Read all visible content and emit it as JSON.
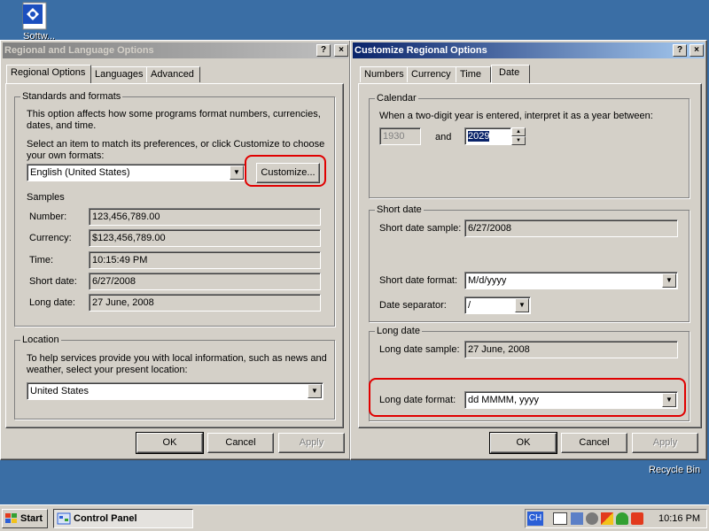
{
  "desktop": {
    "top_icon_label": "Softw...",
    "recycle_bin_label": "Recycle Bin"
  },
  "left_window": {
    "title": "Regional and Language Options",
    "help_btn": "?",
    "close_btn": "×",
    "tabs": [
      "Regional Options",
      "Languages",
      "Advanced"
    ],
    "standards": {
      "title": "Standards and formats",
      "description": "This option affects how some programs format numbers, currencies, dates, and time.",
      "instruction": "Select an item to match its preferences, or click Customize to choose your own formats:",
      "selected_locale": "English (United States)",
      "customize_label": "Customize...",
      "samples_title": "Samples",
      "samples": [
        {
          "label": "Number:",
          "value": "123,456,789.00"
        },
        {
          "label": "Currency:",
          "value": "$123,456,789.00"
        },
        {
          "label": "Time:",
          "value": "10:15:49 PM"
        },
        {
          "label": "Short date:",
          "value": "6/27/2008"
        },
        {
          "label": "Long date:",
          "value": "27 June, 2008"
        }
      ]
    },
    "location": {
      "title": "Location",
      "description": "To help services provide you with local information, such as news and weather, select your present location:",
      "selected": "United States"
    },
    "buttons": {
      "ok": "OK",
      "cancel": "Cancel",
      "apply": "Apply"
    }
  },
  "right_window": {
    "title": "Customize Regional Options",
    "help_btn": "?",
    "close_btn": "×",
    "tabs": [
      "Numbers",
      "Currency",
      "Time",
      "Date"
    ],
    "calendar": {
      "title": "Calendar",
      "description": "When a two-digit year is entered, interpret it as a year between:",
      "from_year": "1930",
      "and_label": "and",
      "to_year": "2029"
    },
    "short_date": {
      "title": "Short date",
      "sample_label": "Short date sample:",
      "sample_value": "6/27/2008",
      "format_label": "Short date format:",
      "format_value": "M/d/yyyy",
      "separator_label": "Date separator:",
      "separator_value": "/"
    },
    "long_date": {
      "title": "Long date",
      "sample_label": "Long date sample:",
      "sample_value": "27 June, 2008",
      "format_label": "Long date format:",
      "format_value": "dd MMMM, yyyy"
    },
    "buttons": {
      "ok": "OK",
      "cancel": "Cancel",
      "apply": "Apply"
    }
  },
  "taskbar": {
    "start_label": "Start",
    "task_label": "Control Panel",
    "lang_indicator": "CH",
    "clock": "10:16 PM"
  },
  "colors": {
    "desktop": "#3a6ea5",
    "title_active": "#0a246a",
    "highlight_ring": "#e00000"
  }
}
